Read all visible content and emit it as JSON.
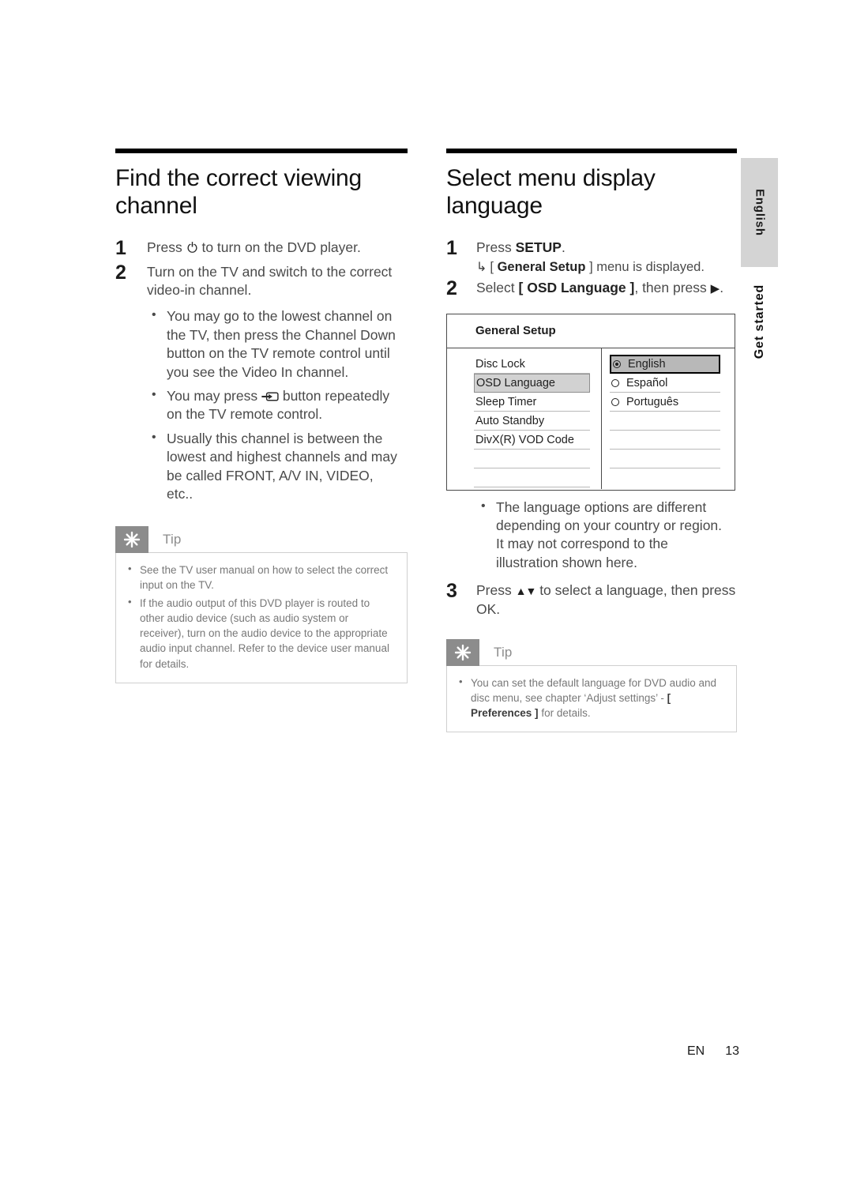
{
  "page": {
    "footer_locale": "EN",
    "footer_page_number": "13"
  },
  "side_tabs": {
    "language_tab": "English",
    "section_tab": "Get started"
  },
  "left_column": {
    "heading": "Find the correct viewing channel",
    "steps": [
      {
        "number": "1",
        "text_before_icon": "Press ",
        "icon": "power-icon",
        "text_after_icon": " to turn on the DVD player."
      },
      {
        "number": "2",
        "text": "Turn on the TV and switch to the correct video-in channel."
      }
    ],
    "bullets": [
      {
        "text": "You may go to the lowest channel on the TV, then press the Channel Down button on the TV remote control until you see the Video In channel."
      },
      {
        "text_before_icon": "You may press ",
        "icon": "tv-source-input-icon",
        "text_after_icon": " button repeatedly on the TV remote control."
      },
      {
        "text": "Usually this channel is between the lowest and highest channels and may be called FRONT, A/V IN, VIDEO, etc.."
      }
    ],
    "tip": {
      "title": "Tip",
      "icon": "tip-starburst-icon",
      "items": [
        "See the TV user manual on how to select the correct input on the TV.",
        "If the audio output of this DVD player is routed to other audio device (such as audio system or receiver), turn on the audio device to the appropriate audio input channel. Refer to the device user manual for details."
      ]
    }
  },
  "right_column": {
    "heading": "Select menu display language",
    "step1": {
      "number": "1",
      "text_plain": "Press ",
      "text_bold": "SETUP",
      "text_tail": ".",
      "result_hook": "↳",
      "result_bracket_open": "[",
      "result_bold": "General Setup",
      "result_bracket_close": "]",
      "result_tail": " menu is displayed."
    },
    "step2": {
      "number": "2",
      "text_plain": "Select ",
      "bracket_open": "[",
      "text_bold": "OSD Language",
      "bracket_close": "]",
      "text_tail": ", then press ",
      "icon": "triangle-right-icon",
      "text_end": "."
    },
    "osd_menu": {
      "title": "General Setup",
      "left_items": [
        {
          "label": "Disc Lock",
          "selected": false
        },
        {
          "label": "OSD Language",
          "selected": true
        },
        {
          "label": "Sleep Timer",
          "selected": false
        },
        {
          "label": "Auto Standby",
          "selected": false
        },
        {
          "label": "DivX(R) VOD Code",
          "selected": false
        },
        {
          "label": "",
          "selected": false
        },
        {
          "label": "",
          "selected": false
        }
      ],
      "right_items": [
        {
          "label": "English",
          "checked": true,
          "highlighted": true
        },
        {
          "label": "Español",
          "checked": false,
          "highlighted": false
        },
        {
          "label": "Português",
          "checked": false,
          "highlighted": false
        },
        {
          "label": "",
          "checked": null,
          "highlighted": false
        },
        {
          "label": "",
          "checked": null,
          "highlighted": false
        },
        {
          "label": "",
          "checked": null,
          "highlighted": false
        },
        {
          "label": "",
          "checked": null,
          "highlighted": false
        }
      ]
    },
    "note_bullet": "The language options are different depending on your country or region. It may not correspond to the illustration shown here.",
    "step3": {
      "number": "3",
      "text_plain": "Press ",
      "icon": "up-down-arrows-icon",
      "text_tail": " to select a language, then press OK."
    },
    "tip": {
      "title": "Tip",
      "icon": "tip-starburst-icon",
      "item_part1": "You can set the default language for DVD audio and disc menu, see chapter ‘Adjust settings’ - ",
      "item_bold": "[ Preferences ]",
      "item_part2": " for details."
    }
  },
  "colors": {
    "rule_black": "#000000",
    "tip_gray": "#8c8c8c",
    "tab_gray": "#d4d4d4",
    "osd_highlight": "#d2d2d2",
    "osd_selected_dark": "#b8b8b8"
  }
}
